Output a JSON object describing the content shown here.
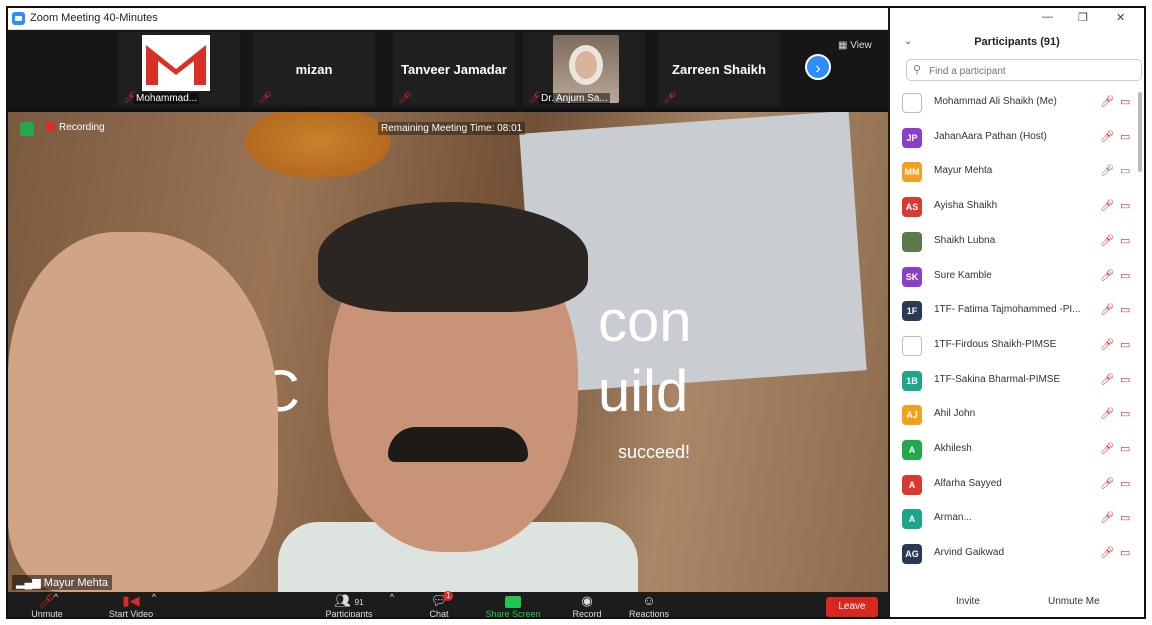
{
  "window": {
    "title": "Zoom Meeting 40-Minutes"
  },
  "strip": {
    "tiles": [
      {
        "name": "",
        "label": "Mohammad..."
      },
      {
        "name": "mizan",
        "label": ""
      },
      {
        "name": "Tanveer Jamadar",
        "label": ""
      },
      {
        "name": "",
        "label": "Dr. Anjum Sa..."
      },
      {
        "name": "Zarreen Shaikh",
        "label": ""
      }
    ],
    "next_icon": "›",
    "view_label": "View"
  },
  "video": {
    "recording": "Recording",
    "remaining": "Remaining Meeting Time: 08:01",
    "speaker": "Mayur Mehta",
    "background_text": [
      "con",
      "C",
      "uild",
      "succeed!"
    ]
  },
  "toolbar": {
    "unmute": "Unmute",
    "start_video": "Start Video",
    "participants": "Participants",
    "participants_count": "91",
    "chat": "Chat",
    "chat_badge": "1",
    "share_screen": "Share Screen",
    "record": "Record",
    "reactions": "Reactions",
    "leave": "Leave"
  },
  "panel": {
    "title": "Participants (91)",
    "search_placeholder": "Find a participant",
    "participants": [
      {
        "initials": "",
        "name": "Mohammad Ali Shaikh (Me)",
        "color": "#ffffff",
        "mic": "muted",
        "cam": "off"
      },
      {
        "initials": "JP",
        "name": "JahanAara Pathan (Host)",
        "color": "#8a3ec9",
        "mic": "muted",
        "cam": "off"
      },
      {
        "initials": "MM",
        "name": "Mayur Mehta",
        "color": "#f2a01f",
        "mic": "on",
        "cam": "on"
      },
      {
        "initials": "AS",
        "name": "Ayisha Shaikh",
        "color": "#d83a2f",
        "mic": "muted",
        "cam": "off"
      },
      {
        "initials": "",
        "name": "Shaikh Lubna",
        "color": "#5a7a4a",
        "mic": "muted",
        "cam": "off"
      },
      {
        "initials": "SK",
        "name": "Sure Kamble",
        "color": "#8a3ec9",
        "mic": "muted",
        "cam": "off"
      },
      {
        "initials": "1F",
        "name": "1TF- Fatima Tajmohammed -PI...",
        "color": "#2a3a55",
        "mic": "muted",
        "cam": "off"
      },
      {
        "initials": "",
        "name": "1TF-Firdous Shaikh-PIMSE",
        "color": "#ffffff",
        "mic": "muted",
        "cam": "off"
      },
      {
        "initials": "1B",
        "name": "1TF-Sakina Bharmal-PIMSE",
        "color": "#1fa58a",
        "mic": "muted",
        "cam": "off"
      },
      {
        "initials": "AJ",
        "name": "Ahil John",
        "color": "#f2a01f",
        "mic": "muted",
        "cam": "off"
      },
      {
        "initials": "A",
        "name": "Akhilesh",
        "color": "#23a94a",
        "mic": "muted",
        "cam": "off"
      },
      {
        "initials": "A",
        "name": "Alfarha Sayyed",
        "color": "#d83a2f",
        "mic": "muted",
        "cam": "off"
      },
      {
        "initials": "A",
        "name": "Arman...",
        "color": "#1fa58a",
        "mic": "muted",
        "cam": "off"
      },
      {
        "initials": "AG",
        "name": "Arvind Gaikwad",
        "color": "#2a3a55",
        "mic": "muted",
        "cam": "off"
      }
    ],
    "invite": "Invite",
    "unmute_me": "Unmute Me"
  },
  "colors": {
    "accent": "#2d8cff",
    "danger": "#e02828",
    "share": "#23c553"
  }
}
